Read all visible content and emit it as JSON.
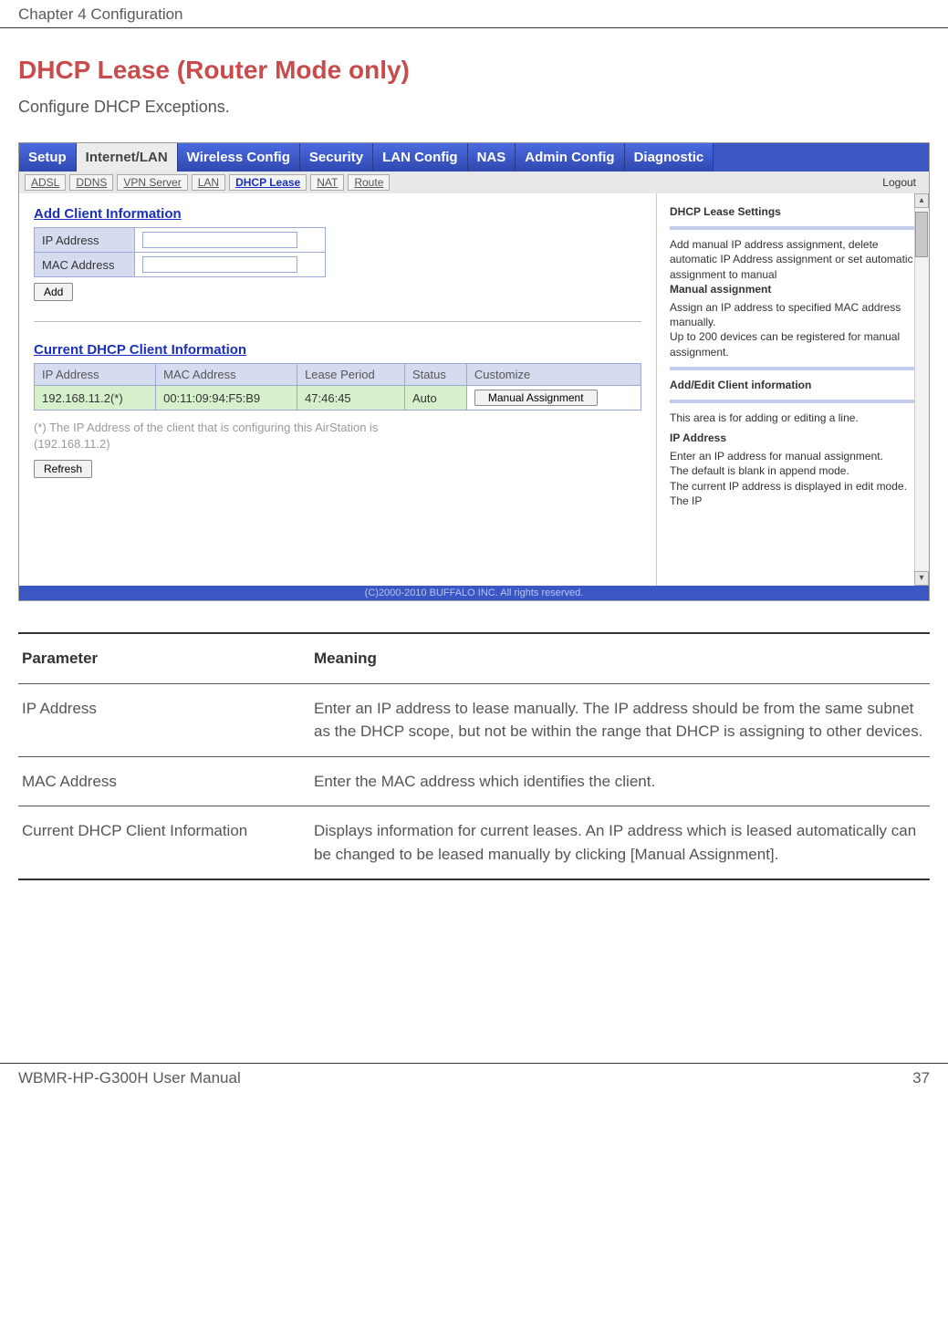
{
  "header": {
    "chapter": "Chapter 4  Configuration"
  },
  "title": "DHCP Lease (Router Mode only)",
  "subtitle": "Configure DHCP Exceptions.",
  "ui": {
    "main_tabs": [
      "Setup",
      "Internet/LAN",
      "Wireless Config",
      "Security",
      "LAN Config",
      "NAS",
      "Admin Config",
      "Diagnostic"
    ],
    "active_main_tab": "Internet/LAN",
    "sub_tabs": [
      "ADSL",
      "DDNS",
      "VPN Server",
      "LAN",
      "DHCP Lease",
      "NAT",
      "Route"
    ],
    "active_sub_tab": "DHCP Lease",
    "logout": "Logout",
    "add_client": {
      "heading": "Add Client Information",
      "ip_label": "IP Address",
      "mac_label": "MAC Address",
      "ip_value": "",
      "mac_value": "",
      "add_btn": "Add"
    },
    "current": {
      "heading": "Current DHCP Client Information",
      "cols": [
        "IP Address",
        "MAC Address",
        "Lease Period",
        "Status",
        "Customize"
      ],
      "row": {
        "ip": "192.168.11.2(*)",
        "mac": "00:11:09:94:F5:B9",
        "lease": "47:46:45",
        "status": "Auto",
        "customize_btn": "Manual Assignment"
      },
      "note_l1": "(*) The IP Address of the client that is configuring this AirStation is",
      "note_l2": "(192.168.11.2)",
      "refresh_btn": "Refresh"
    },
    "side": {
      "h1": "DHCP Lease Settings",
      "p1": "Add manual IP address assignment, delete automatic IP Address assignment or set automatic assignment to manual",
      "b1": "Manual assignment",
      "p2": "Assign an IP address to specified MAC address manually.",
      "p3": "Up to 200 devices can be registered for manual assignment.",
      "h2": "Add/Edit Client information",
      "p4": "This area is for adding or editing a line.",
      "h3": "IP Address",
      "p5": "Enter an IP address for manual assignment.",
      "p6": "The default is blank in append mode.",
      "p7": "The current IP address is displayed in edit mode. The IP"
    },
    "copyright": "(C)2000-2010 BUFFALO INC. All rights reserved."
  },
  "params": {
    "head_param": "Parameter",
    "head_meaning": "Meaning",
    "rows": [
      {
        "p": "IP Address",
        "m": "Enter an IP address to lease manually. The IP address should be from the same subnet as the DHCP scope, but not be within the range that DHCP is assigning to other devices."
      },
      {
        "p": "MAC Address",
        "m": "Enter the MAC address which identifies the client."
      },
      {
        "p": "Current DHCP Client Information",
        "m": "Displays information for current leases. An IP address which is leased automatically can be changed to be leased manually by clicking [Manual Assignment]."
      }
    ]
  },
  "footer": {
    "manual": "WBMR-HP-G300H User Manual",
    "page": "37"
  }
}
